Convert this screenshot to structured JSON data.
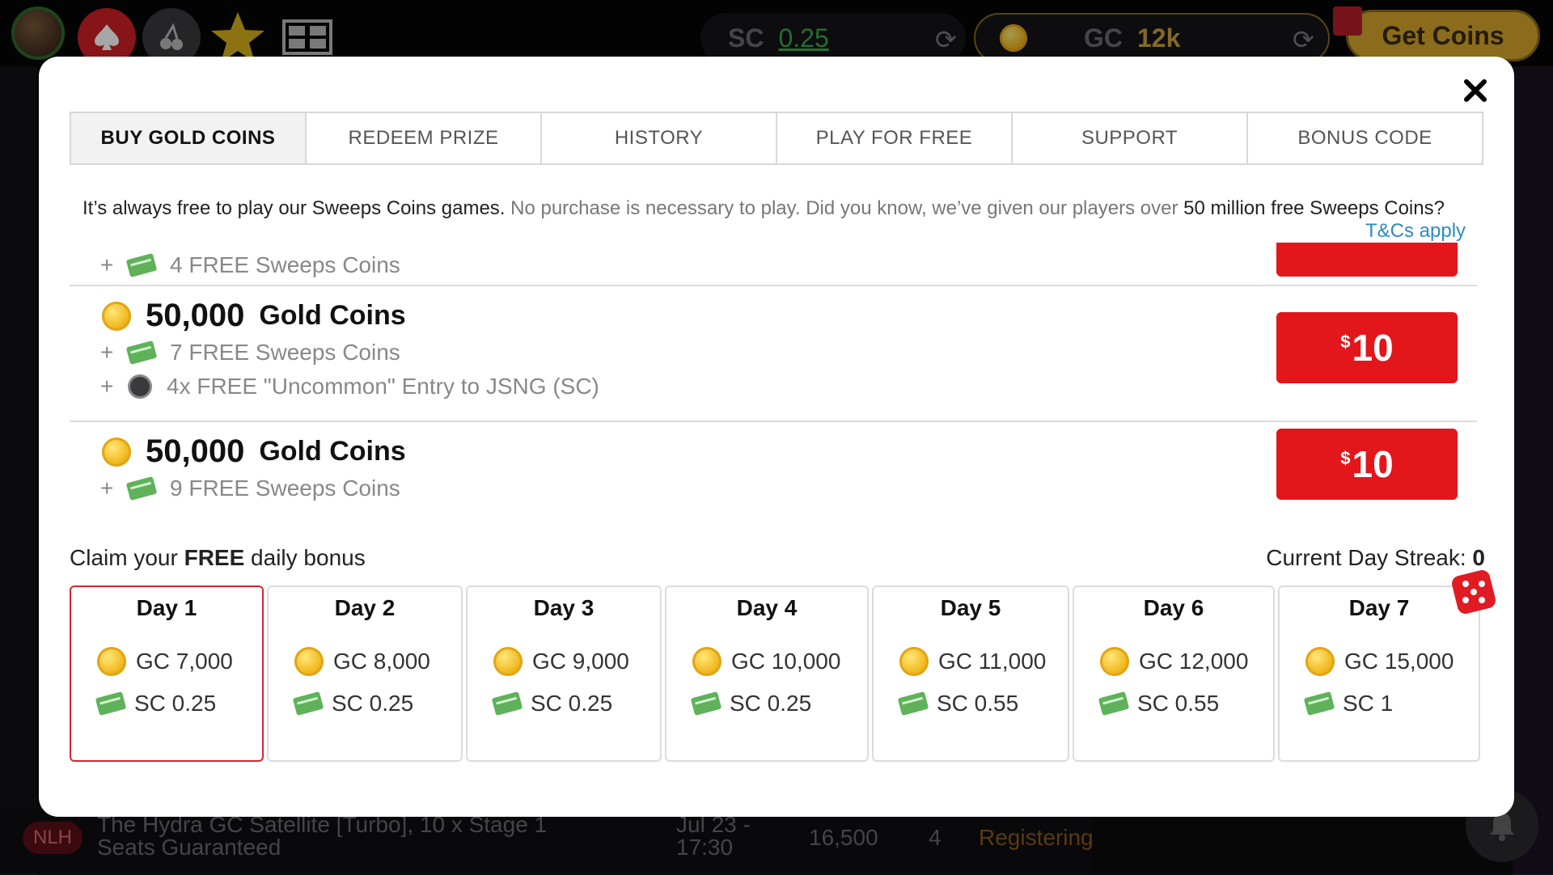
{
  "topbar": {
    "sc_label": "SC",
    "sc_value": "0.25",
    "gc_label": "GC",
    "gc_value": "12k",
    "get_coins_label": "Get Coins"
  },
  "modal": {
    "tabs": [
      {
        "label": "BUY GOLD COINS",
        "active": true
      },
      {
        "label": "REDEEM PRIZE",
        "active": false
      },
      {
        "label": "HISTORY",
        "active": false
      },
      {
        "label": "PLAY FOR FREE",
        "active": false
      },
      {
        "label": "SUPPORT",
        "active": false
      },
      {
        "label": "BONUS CODE",
        "active": false
      }
    ],
    "info_part1": "It’s always free to play our Sweeps Coins games.",
    "info_part2": " No purchase is necessary to play. Did you know, we’ve given our players over ",
    "info_part3": "50 million free Sweeps Coins?",
    "tcs_label": "T&Cs apply",
    "partial_perk": "4 FREE Sweeps Coins",
    "packages": [
      {
        "amount": "50,000",
        "unit": "Gold Coins",
        "perks": [
          "7 FREE Sweeps Coins",
          "4x FREE \"Uncommon\" Entry to JSNG (SC)"
        ],
        "price_currency": "$",
        "price_value": "10"
      },
      {
        "amount": "50,000",
        "unit": "Gold Coins",
        "perks": [
          "9 FREE Sweeps Coins"
        ],
        "price_currency": "$",
        "price_value": "10"
      }
    ],
    "plus": "+",
    "daily": {
      "claim_prefix": "Claim your ",
      "claim_bold": "FREE",
      "claim_suffix": " daily bonus",
      "streak_label": "Current Day Streak: ",
      "streak_value": "0",
      "days": [
        {
          "label": "Day 1",
          "gc": "GC 7,000",
          "sc": "SC 0.25",
          "active": true
        },
        {
          "label": "Day 2",
          "gc": "GC 8,000",
          "sc": "SC 0.25",
          "active": false
        },
        {
          "label": "Day 3",
          "gc": "GC 9,000",
          "sc": "SC 0.25",
          "active": false
        },
        {
          "label": "Day 4",
          "gc": "GC 10,000",
          "sc": "SC 0.25",
          "active": false
        },
        {
          "label": "Day 5",
          "gc": "GC 11,000",
          "sc": "SC 0.55",
          "active": false
        },
        {
          "label": "Day 6",
          "gc": "GC 12,000",
          "sc": "SC 0.55",
          "active": false
        },
        {
          "label": "Day 7",
          "gc": "GC 15,000",
          "sc": "SC 1",
          "active": false
        }
      ]
    }
  },
  "background_list": {
    "game_type": "NLH",
    "title": "The Hydra GC Satellite [Turbo], 10 x Stage 1 Seats Guaranteed",
    "date": "Jul 23 - 17:30",
    "prize": "16,500",
    "players": "4",
    "status": "Registering"
  },
  "colors": {
    "accent_red": "#e3161c",
    "link_blue": "#2a8cc4",
    "gold": "#f0b81e",
    "green": "#5fb25a"
  }
}
